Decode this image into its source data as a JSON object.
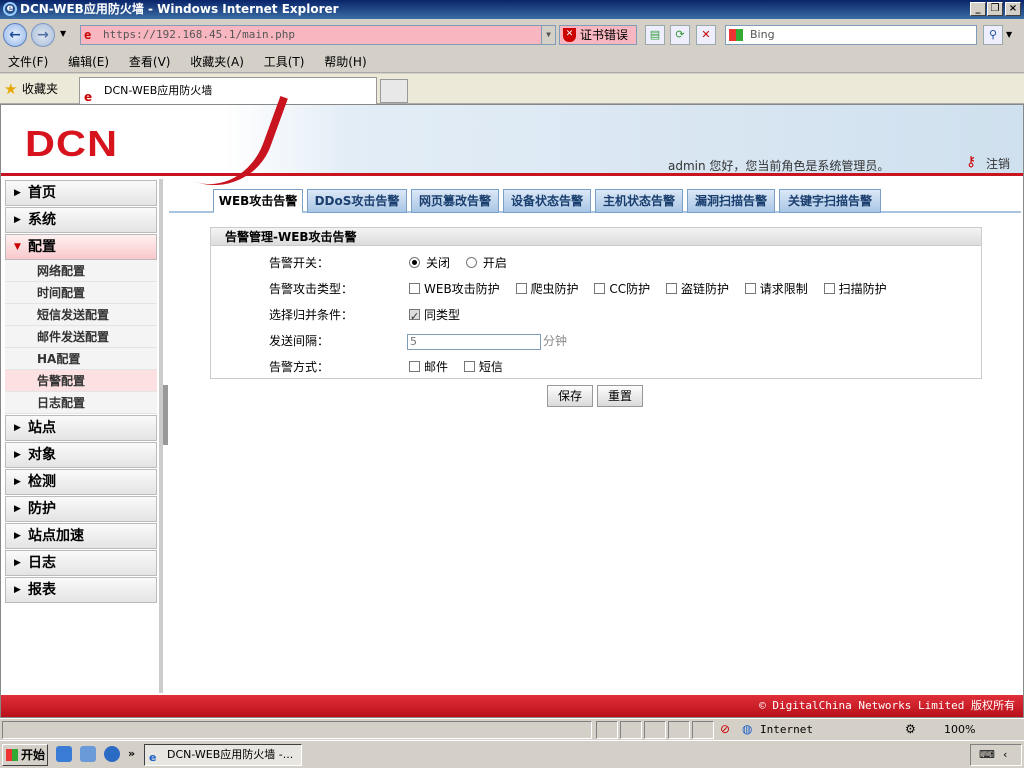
{
  "window": {
    "title": "DCN-WEB应用防火墙 - Windows Internet Explorer"
  },
  "browser": {
    "url": "https://192.168.45.1/main.php",
    "cert_error": "证书错误",
    "search_placeholder": "Bing",
    "menu": [
      "文件(F)",
      "编辑(E)",
      "查看(V)",
      "收藏夹(A)",
      "工具(T)",
      "帮助(H)"
    ],
    "favorites_label": "收藏夹",
    "tab_title": "DCN-WEB应用防火墙"
  },
  "app": {
    "logo": "DCN",
    "greeting": "admin 您好，您当前角色是系统管理员。",
    "logout": "注销",
    "footer": "© DigitalChina Networks Limited 版权所有"
  },
  "sidebar": {
    "top": [
      {
        "label": "首页"
      },
      {
        "label": "系统"
      }
    ],
    "active": {
      "label": "配置"
    },
    "subs": [
      {
        "label": "网络配置"
      },
      {
        "label": "时间配置"
      },
      {
        "label": "短信发送配置"
      },
      {
        "label": "邮件发送配置"
      },
      {
        "label": "HA配置"
      },
      {
        "label": "告警配置"
      },
      {
        "label": "日志配置"
      }
    ],
    "bottom": [
      {
        "label": "站点"
      },
      {
        "label": "对象"
      },
      {
        "label": "检测"
      },
      {
        "label": "防护"
      },
      {
        "label": "站点加速"
      },
      {
        "label": "日志"
      },
      {
        "label": "报表"
      }
    ]
  },
  "tabs": [
    "WEB攻击告警",
    "DDoS攻击告警",
    "网页篡改告警",
    "设备状态告警",
    "主机状态告警",
    "漏洞扫描告警",
    "关键字扫描告警"
  ],
  "panel": {
    "title": "告警管理-WEB攻击告警",
    "switch_label": "告警开关：",
    "switch_off": "关闭",
    "switch_on": "开启",
    "types_label": "告警攻击类型：",
    "types": [
      "WEB攻击防护",
      "爬虫防护",
      "CC防护",
      "盗链防护",
      "请求限制",
      "扫描防护"
    ],
    "merge_label": "选择归并条件：",
    "merge_option": "同类型",
    "interval_label": "发送间隔：",
    "interval_value": "5",
    "interval_unit": "分钟",
    "method_label": "告警方式：",
    "methods": [
      "邮件",
      "短信"
    ],
    "save": "保存",
    "reset": "重置"
  },
  "statusbar": {
    "zone": "Internet",
    "zoom": "100%"
  },
  "taskbar": {
    "start": "开始",
    "task": "DCN-WEB应用防火墙 -..."
  }
}
